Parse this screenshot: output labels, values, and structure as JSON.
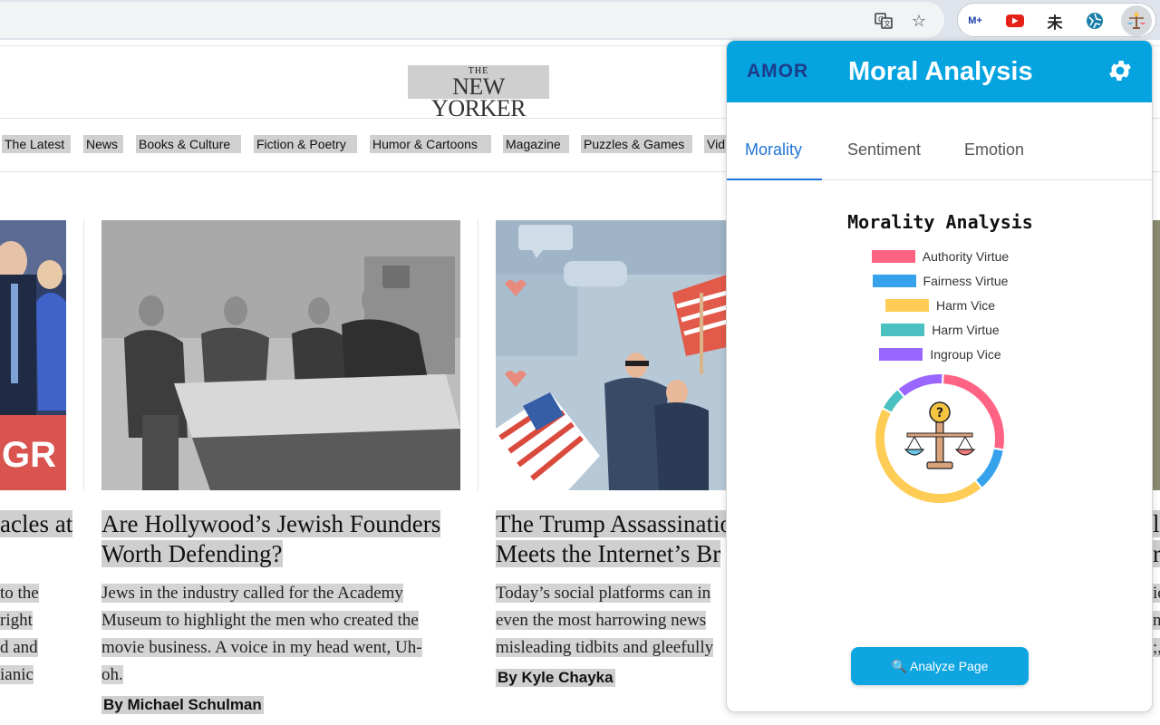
{
  "browser": {
    "extensions": [
      "translate-icon",
      "bookmark-star-icon",
      "movistar-plus-icon",
      "youtube-icon",
      "kanji-icon",
      "globe-icon",
      "amor-extension-icon"
    ],
    "movistar_label": "M+",
    "kanji_label": "未"
  },
  "site": {
    "logo_the": "THE",
    "logo_name": "NEW YORKER",
    "nav": [
      "The Latest",
      "News",
      "Books & Culture",
      "Fiction & Poetry",
      "Humor & Cartoons",
      "Magazine",
      "Puzzles & Games",
      "Vid"
    ]
  },
  "articles": [
    {
      "headline": [
        "acles at"
      ],
      "dek": [
        "to the",
        "right",
        "d and",
        "ianic"
      ],
      "image_text": "GR"
    },
    {
      "headline": [
        "Are Hollywood’s Jewish Founders",
        "Worth Defending?"
      ],
      "dek": [
        "Jews in the industry called for the Academy",
        "Museum to highlight the men who created the",
        "movie business. A voice in my head went, Uh-",
        "oh."
      ],
      "byline": "By Michael Schulman"
    },
    {
      "headline": [
        "The Trump Assassinatio",
        "Meets the Internet’s Br"
      ],
      "dek": [
        "Today’s social platforms can in",
        "even the most harrowing news",
        "misleading tidbits and gleefully"
      ],
      "byline": "By Kyle Chayka"
    },
    {
      "headline": [
        "l",
        "r"
      ],
      "dek": [
        "ic",
        "n",
        ";,"
      ]
    }
  ],
  "popup": {
    "logo": "AMOR",
    "title": "Moral Analysis",
    "tabs": [
      "Morality",
      "Sentiment",
      "Emotion"
    ],
    "active_tab": "Morality",
    "analyze_button": "Analyze Page"
  },
  "chart_data": {
    "type": "pie",
    "variant": "doughnut",
    "title": "Morality Analysis",
    "legend_position": "top",
    "categories": [
      "Authority Virtue",
      "Fairness Virtue",
      "Harm Vice",
      "Harm Virtue",
      "Ingroup Vice"
    ],
    "colors": [
      "#ff6384",
      "#36a2eb",
      "#ffcd56",
      "#4bc0c0",
      "#9966ff"
    ],
    "values": [
      27,
      11,
      44,
      6,
      12
    ]
  }
}
